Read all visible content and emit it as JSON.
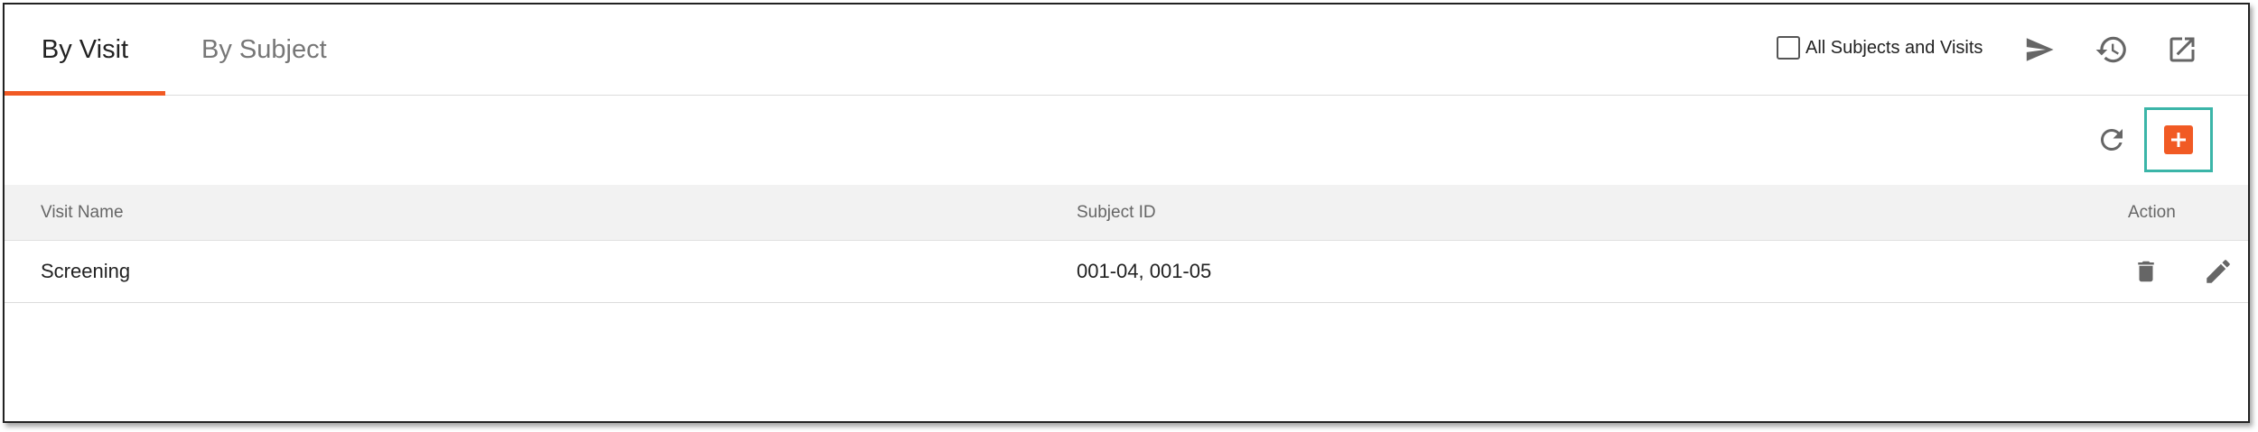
{
  "tabs": [
    {
      "label": "By Visit",
      "active": true
    },
    {
      "label": "By Subject",
      "active": false
    }
  ],
  "header": {
    "all_subjects_checkbox": {
      "label": "All Subjects and Visits",
      "checked": false
    },
    "icons": [
      "send-icon",
      "history-icon",
      "open-external-icon"
    ]
  },
  "toolbar": {
    "icons": [
      "refresh-icon",
      "add-icon"
    ]
  },
  "table": {
    "columns": [
      "Visit Name",
      "Subject ID",
      "Action"
    ],
    "rows": [
      {
        "visit_name": "Screening",
        "subject_id": "001-04, 001-05",
        "actions": [
          "delete-icon",
          "edit-icon"
        ]
      }
    ]
  },
  "colors": {
    "accent": "#f15a24",
    "highlight": "#3bb5a8",
    "header_bg": "#f2f2f2",
    "icon": "#666666"
  }
}
